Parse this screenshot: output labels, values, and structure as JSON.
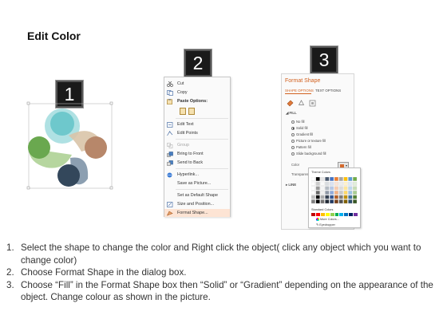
{
  "title": "Edit Color",
  "steps": [
    "1",
    "2",
    "3"
  ],
  "colors": {
    "teal": "#6ec8cc",
    "green": "#6aa84f",
    "light_green": "#a9cf8e",
    "tan": "#d9c4a8",
    "brown": "#b7876a",
    "slate": "#7f95a8",
    "navy": "#33475b",
    "accent": "#d2611f",
    "highlight": "#fde4d4"
  },
  "context_menu": {
    "items": [
      {
        "label": "Cut",
        "icon": "scissors-icon",
        "dim": false
      },
      {
        "label": "Copy",
        "icon": "copy-icon",
        "dim": false
      },
      {
        "label": "Paste Options:",
        "icon": "clipboard-icon",
        "dim": false
      },
      {
        "label": "Edit Text",
        "icon": "edit-text-icon",
        "dim": false
      },
      {
        "label": "Edit Points",
        "icon": "edit-points-icon",
        "dim": false
      },
      {
        "label": "Group",
        "icon": "group-icon",
        "dim": true
      },
      {
        "label": "Bring to Front",
        "icon": "bring-front-icon",
        "dim": false
      },
      {
        "label": "Send to Back",
        "icon": "send-back-icon",
        "dim": false
      },
      {
        "label": "Hyperlink...",
        "icon": "hyperlink-icon",
        "dim": false
      },
      {
        "label": "Save as Picture...",
        "icon": "",
        "dim": false
      },
      {
        "label": "Set as Default Shape",
        "icon": "",
        "dim": false
      },
      {
        "label": "Size and Position...",
        "icon": "size-position-icon",
        "dim": false
      },
      {
        "label": "Format Shape...",
        "icon": "format-shape-icon",
        "dim": false
      }
    ]
  },
  "format_pane": {
    "title": "Format Shape",
    "tabs": [
      "SHAPE OPTIONS",
      "TEXT OPTIONS"
    ],
    "fill_section": "FILL",
    "fill_options": [
      "No fill",
      "Solid fill",
      "Gradient fill",
      "Picture or texture fill",
      "Pattern fill",
      "Slide background fill"
    ],
    "selected_fill": "Solid fill",
    "color_label": "Color",
    "transparency_label": "Transparency",
    "line_section": "LINE"
  },
  "palette": {
    "theme_label": "Theme Colors",
    "standard_label": "Standard Colors",
    "more_colors": "More Colors...",
    "eyedropper": "Eyedropper",
    "theme_top": [
      "#ffffff",
      "#000000",
      "#e7e6e6",
      "#44546a",
      "#4472c4",
      "#ed7d31",
      "#a5a5a5",
      "#ffc000",
      "#5b9bd5",
      "#70ad47"
    ],
    "standard": [
      "#c00000",
      "#ff0000",
      "#ffc000",
      "#ffff00",
      "#92d050",
      "#00b050",
      "#00b0f0",
      "#0070c0",
      "#002060",
      "#7030a0"
    ]
  },
  "instructions": [
    {
      "num": "1.",
      "text": "Select the shape to change the color and Right click the object( click any object which you want to change color)"
    },
    {
      "num": "2.",
      "text": "Choose Format Shape in the dialog box."
    },
    {
      "num": "3.",
      "text": "Choose “Fill” in the Format Shape box then “Solid” or “Gradient” depending on the appearance of the object. Change colour as shown in the picture."
    }
  ]
}
